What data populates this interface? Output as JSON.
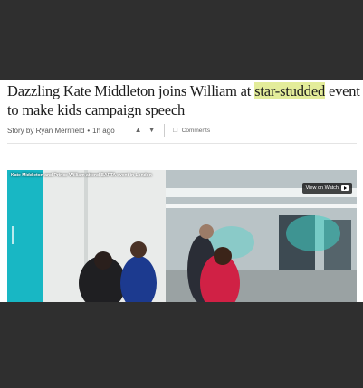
{
  "article": {
    "headline_before": "Dazzling Kate Middleton joins William at ",
    "headline_highlight": "star-studded",
    "headline_after": " event to make kids campaign speech",
    "byline": "Story by Ryan Merrifield",
    "separator": "•",
    "time_ago": "1h ago",
    "comments_label": "Comments",
    "highlight_color": "#e3ec9a"
  },
  "video": {
    "caption": "Kate Middleton and Prince William attend BAFTA event in London",
    "watch_label": "View on Watch"
  },
  "icons": {
    "like": "thumbs-up-icon",
    "dislike": "thumbs-down-icon",
    "comment": "comment-bubble-icon",
    "play": "play-icon"
  }
}
